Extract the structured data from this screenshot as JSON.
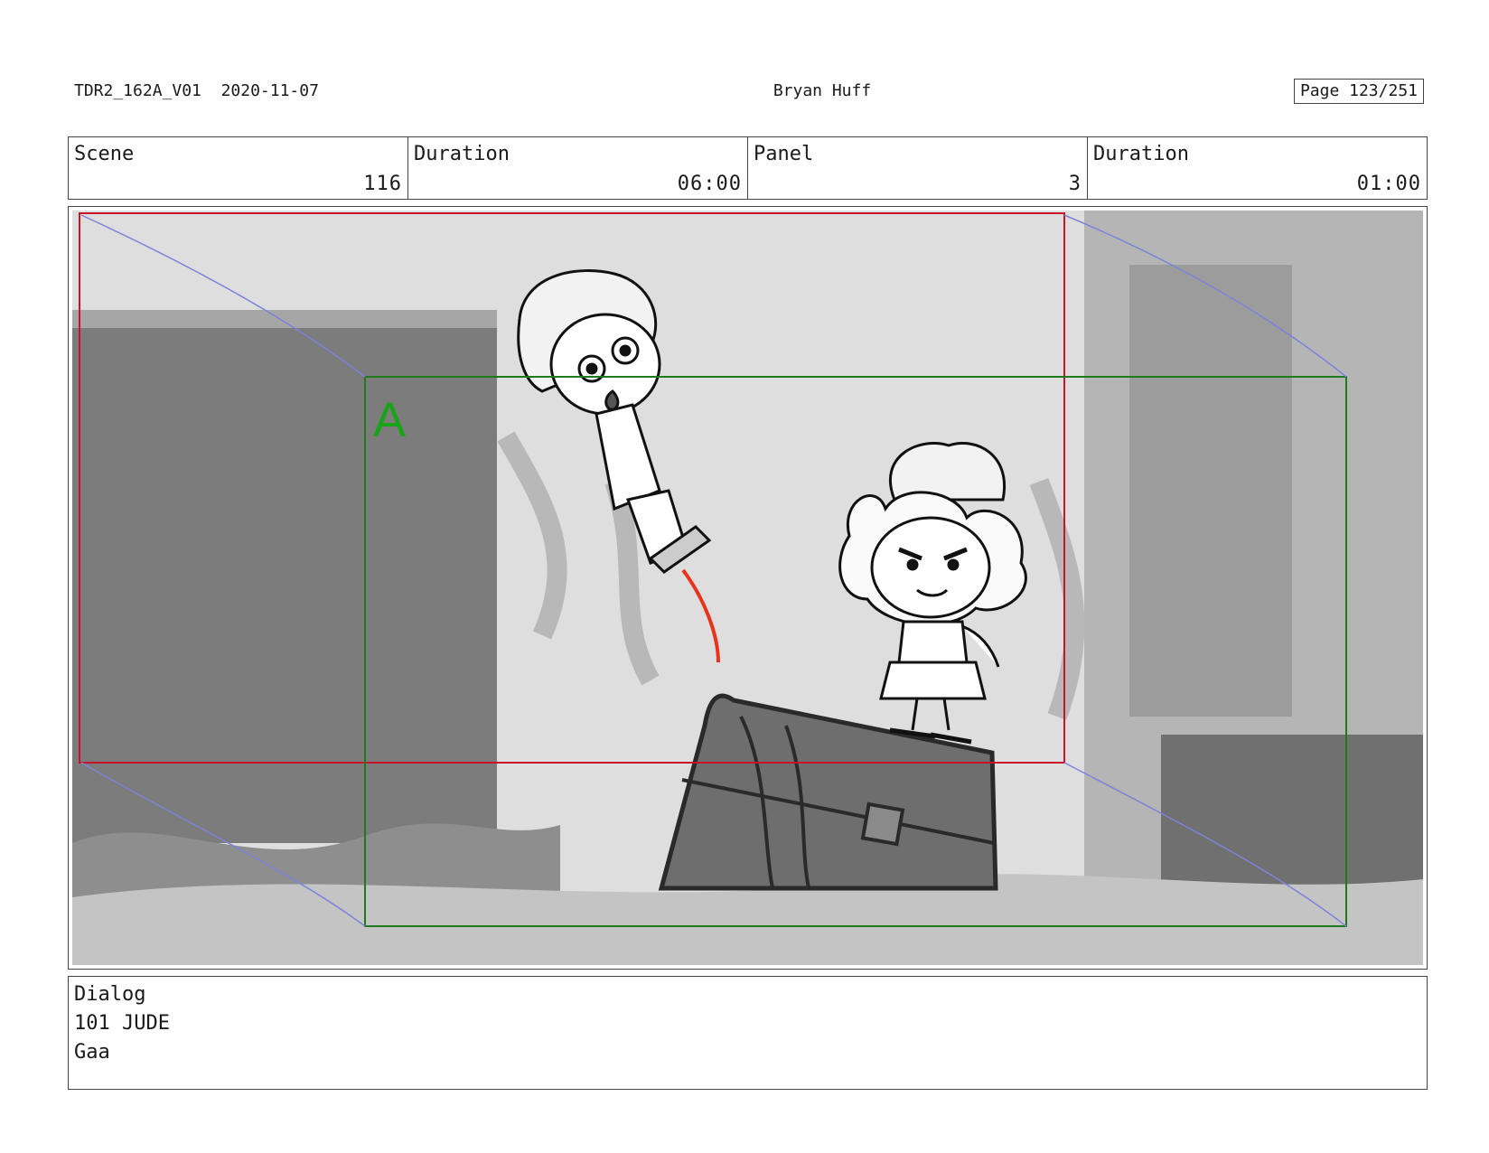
{
  "header": {
    "production_id": "TDR2_162A_V01",
    "date": "2020-11-07",
    "artist": "Bryan Huff",
    "page": "Page 123/251"
  },
  "info": {
    "scene_label": "Scene",
    "scene_value": "116",
    "scene_duration_label": "Duration",
    "scene_duration_value": "06:00",
    "panel_label": "Panel",
    "panel_value": "3",
    "panel_duration_label": "Duration",
    "panel_duration_value": "01:00"
  },
  "panel": {
    "camera_label": "A",
    "colors": {
      "start_frame": "#c8142a",
      "end_frame": "#1f7a1f",
      "camera_label": "#19a319",
      "motion_path": "#7b84d9",
      "action_line": "#e8341c"
    }
  },
  "dialog": {
    "label": "Dialog",
    "character": "101 JUDE",
    "line": "Gaa"
  }
}
